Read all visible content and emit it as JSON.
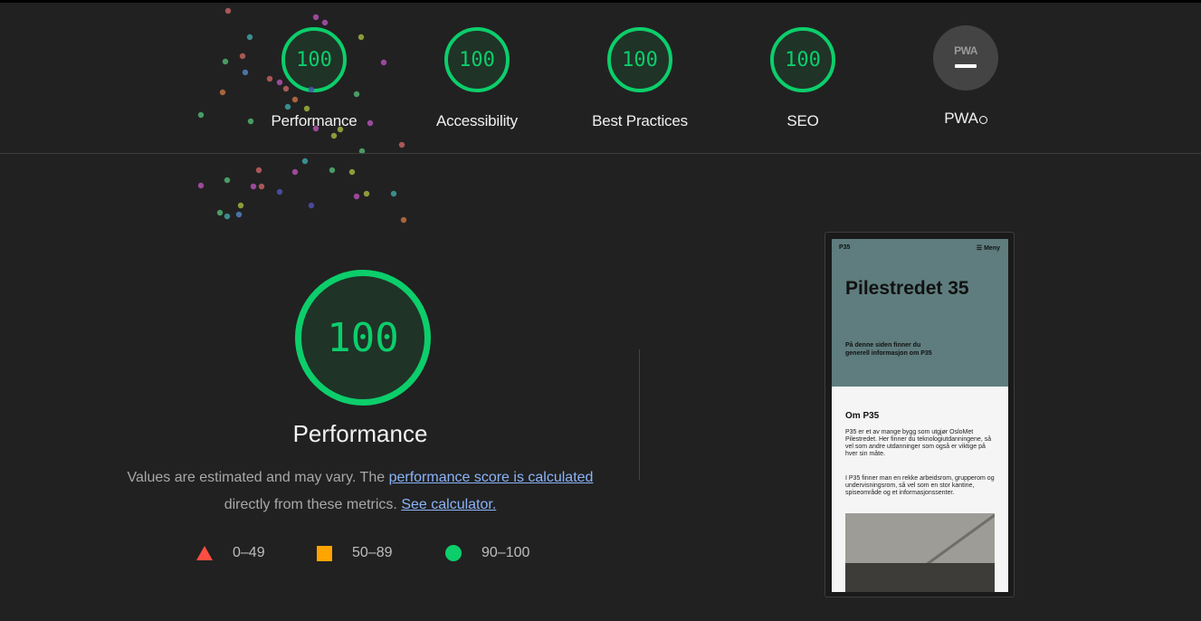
{
  "header": {
    "gauges": [
      {
        "score": "100",
        "label": "Performance"
      },
      {
        "score": "100",
        "label": "Accessibility"
      },
      {
        "score": "100",
        "label": "Best Practices"
      },
      {
        "score": "100",
        "label": "SEO"
      }
    ],
    "pwa": {
      "logo": "PWA",
      "label": "PWA"
    }
  },
  "main": {
    "score": "100",
    "title": "Performance",
    "desc_prefix": "Values are estimated and may vary. The ",
    "desc_link": "performance score is calculated",
    "desc_middle": " directly from these metrics. ",
    "desc_link2": "See calculator.",
    "legend": [
      {
        "range": "0–49",
        "color": "#ff4e42"
      },
      {
        "range": "50–89",
        "color": "#ffa400"
      },
      {
        "range": "90–100",
        "color": "#0cce6b"
      }
    ]
  },
  "screenshot": {
    "brand": "P35",
    "menu": "☰ Meny",
    "hero_title": "Pilestredet 35",
    "hero_sub": "På denne siden finner du generell informasjon om P35",
    "section_title": "Om P35",
    "para1": "P35 er et av mange bygg som utgjør OsloMet Pilestredet. Her finner du teknologiutdanningene, så vel som andre utdanninger som også er viktige på hver sin måte.",
    "para2": "I P35 finner man en rekke arbeidsrom, grupperom og undervisningsrom, så vel som en stor kantine, spiseområde og et informasjonssenter."
  },
  "colors": {
    "pass": "#0cce6b",
    "average": "#ffa400",
    "fail": "#ff4e42",
    "link": "#8ab4f8"
  }
}
